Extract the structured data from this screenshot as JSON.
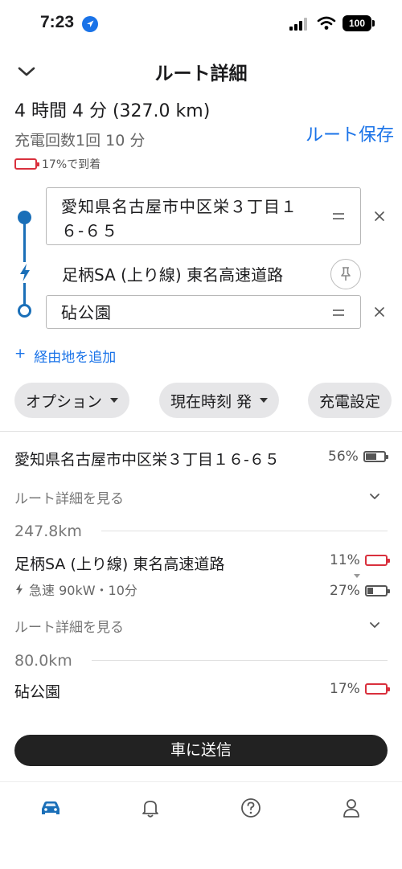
{
  "status_bar": {
    "time": "7:23",
    "battery": "100"
  },
  "header": {
    "title": "ルート詳細"
  },
  "summary": {
    "duration_distance": "4 時間 4 分 (327.0 km)",
    "charge_info": "充電回数1回 10 分",
    "arrival_battery": "17%で到着",
    "save_route": "ルート保存"
  },
  "route": {
    "origin": "愛知県名古屋市中区栄３丁目１６-６５",
    "charge_stop": "足柄SA (上り線) 東名高速道路",
    "destination": "砧公園",
    "add_waypoint": "経由地を追加",
    "add_icon": "+"
  },
  "chips": [
    {
      "label": "オプション"
    },
    {
      "label": "現在時刻 発"
    },
    {
      "label": "充電設定"
    }
  ],
  "itinerary": {
    "start": {
      "name": "愛知県名古屋市中区栄３丁目１６-６５",
      "battery": "56%"
    },
    "details_link_1": "ルート詳細を見る",
    "leg_1_distance": "247.8km",
    "stop": {
      "name": "足柄SA (上り線) 東名高速道路",
      "charger": "急速 90kW・10分",
      "arrive_battery": "11%",
      "depart_battery": "27%"
    },
    "details_link_2": "ルート詳細を見る",
    "leg_2_distance": "80.0km",
    "end": {
      "name": "砧公園",
      "battery": "17%"
    }
  },
  "send_button": "車に送信",
  "bottom_nav": [
    {
      "icon": "car-icon",
      "active": true
    },
    {
      "icon": "bell-icon",
      "active": false
    },
    {
      "icon": "help-icon",
      "active": false
    },
    {
      "icon": "person-icon",
      "active": false
    }
  ],
  "colors": {
    "accent": "#1a73e8",
    "route": "#1a6fb8",
    "low_battery": "#d9303d"
  }
}
